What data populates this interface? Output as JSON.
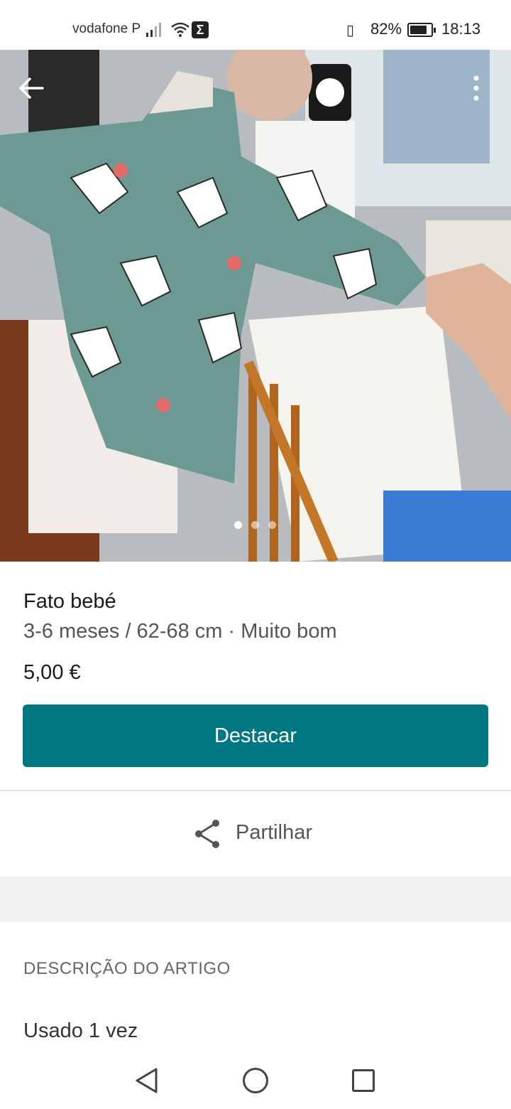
{
  "status_bar": {
    "carrier": "vodafone P",
    "battery_percent": "82%",
    "battery_level": 0.82,
    "time": "18:13",
    "sigma_label": "Σ"
  },
  "gallery": {
    "image_count": 3,
    "active_index": 0
  },
  "item": {
    "title": "Fato bebé",
    "details": "3-6 meses / 62-68 cm · Muito bom",
    "price": "5,00 €"
  },
  "actions": {
    "promote_label": "Destacar",
    "share_label": "Partilhar"
  },
  "description": {
    "section_title": "DESCRIÇÃO DO ARTIGO",
    "text": "Usado 1 vez"
  },
  "colors": {
    "accent": "#007782",
    "background": "#ffffff",
    "band": "#f1f1f1"
  },
  "icons": {
    "back": "arrow-left-icon",
    "menu": "more-vertical-icon",
    "share": "share-icon",
    "nav_back": "triangle-back-icon",
    "nav_home": "circle-home-icon",
    "nav_recent": "square-recents-icon"
  }
}
